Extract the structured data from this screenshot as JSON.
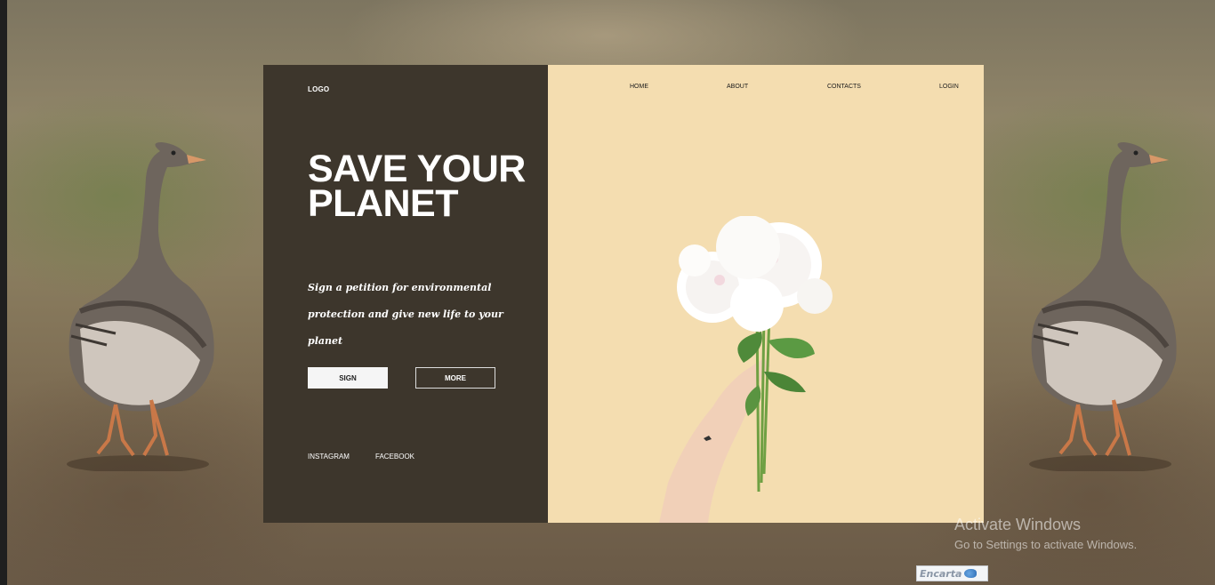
{
  "header": {
    "logo": "LOGO"
  },
  "nav": {
    "home": "HOME",
    "about": "ABOUT",
    "contacts": "CONTACTS",
    "login": "LOGIN"
  },
  "hero": {
    "title": "SAVE YOUR PLANET",
    "description": "Sign a petition for environmental protection and give new life to your planet"
  },
  "buttons": {
    "sign": "SIGN",
    "more": "MORE"
  },
  "social": {
    "instagram": "INSTAGRAM",
    "facebook": "FACEBOOK"
  },
  "system": {
    "activate_title": "Activate Windows",
    "activate_subtitle": "Go to Settings to activate Windows.",
    "encarta": "Encarta"
  },
  "colors": {
    "left_panel": "#3d362c",
    "right_panel": "#f4ddb0",
    "button_light": "#f5f5f5"
  },
  "icons": {
    "bouquet": "white-peony-bouquet-image",
    "goose": "goose-image"
  }
}
